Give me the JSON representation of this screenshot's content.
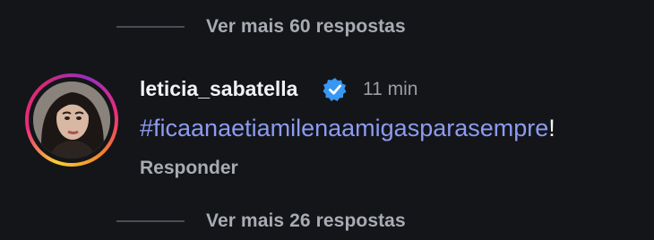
{
  "thread": {
    "more_replies_top": "Ver mais 60 respostas",
    "more_replies_bottom": "Ver mais 26 respostas"
  },
  "comment": {
    "username": "leticia_sabatella",
    "verified_icon": "verified-badge-icon",
    "time": "11 min",
    "hashtag": "#ficaanaetiamilenaamigasparasempre",
    "suffix": "!",
    "reply_label": "Responder"
  },
  "colors": {
    "background": "#131519",
    "hashtag": "#8c9bf0",
    "verified": "#3897f0"
  }
}
